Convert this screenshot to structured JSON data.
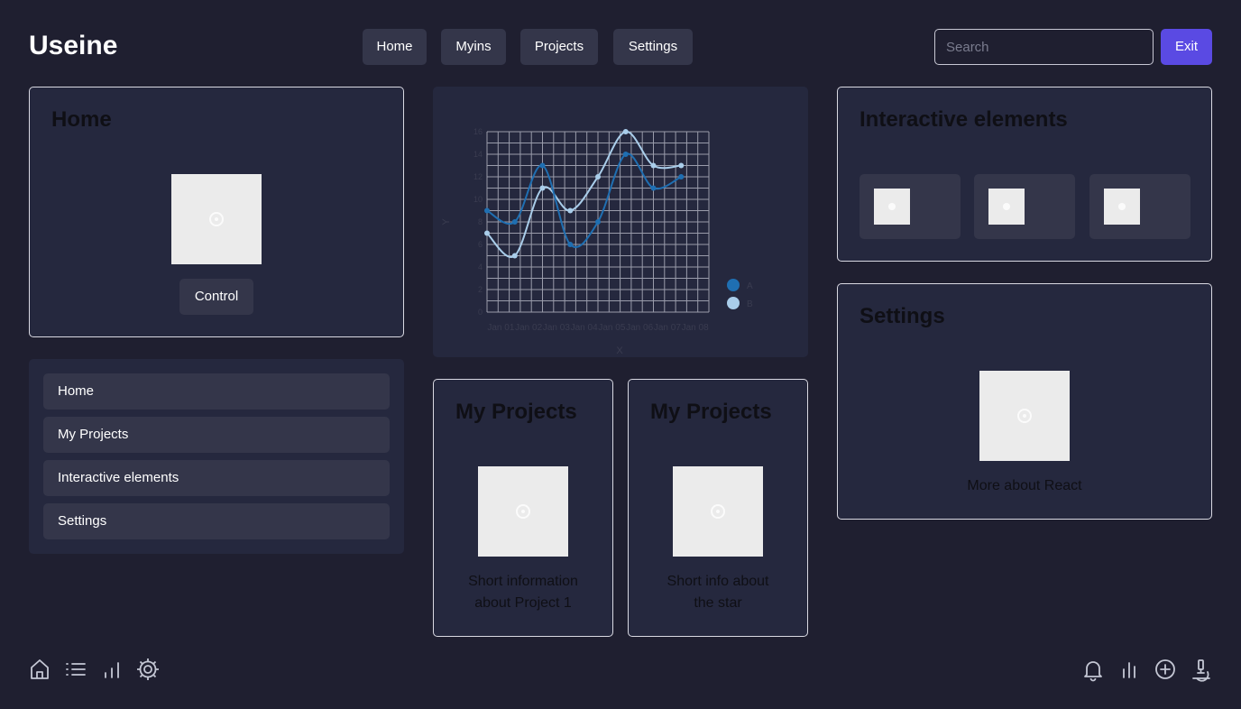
{
  "header": {
    "brand": "Useine",
    "nav": [
      {
        "label": "Home"
      },
      {
        "label": "Myins"
      },
      {
        "label": "Projects"
      },
      {
        "label": "Settings"
      }
    ],
    "search_placeholder": "Search",
    "exit_label": "Exit"
  },
  "home_card": {
    "title": "Home",
    "button_label": "Control"
  },
  "side_menu": {
    "items": [
      {
        "label": "Home"
      },
      {
        "label": "My Projects"
      },
      {
        "label": "Interactive elements"
      },
      {
        "label": "Settings"
      }
    ]
  },
  "chart_data": {
    "type": "line",
    "categories": [
      "Jan 01",
      "Jan 02",
      "Jan 03",
      "Jan 04",
      "Jan 05",
      "Jan 06",
      "Jan 07",
      "Jan 08"
    ],
    "x": [
      1,
      2,
      3,
      4,
      5,
      6,
      7,
      8,
      9
    ],
    "x_tick_labels": [
      "Jan 01",
      "Jan 02",
      "Jan 03",
      "Jan 04",
      "Jan 05",
      "Jan 06",
      "Jan 07",
      "Jan 08"
    ],
    "series": [
      {
        "name": "A",
        "color": "#1f6fb2",
        "values": [
          9,
          8,
          13,
          6,
          8,
          14,
          11,
          12
        ]
      },
      {
        "name": "B",
        "color": "#a9cdea",
        "values": [
          7,
          5,
          11,
          9,
          12,
          16,
          13,
          13
        ]
      }
    ],
    "xlabel": "X",
    "ylabel": "Y",
    "y_ticks": [
      0,
      2,
      4,
      6,
      8,
      10,
      12,
      14,
      16
    ],
    "ylim": [
      0,
      16
    ],
    "grid": true,
    "legend": "right"
  },
  "projects": [
    {
      "title": "My Projects",
      "text": "Short information about Project 1"
    },
    {
      "title": "My Projects",
      "text": "Short info about the star"
    }
  ],
  "interactive_card": {
    "title": "Interactive elements"
  },
  "settings_card": {
    "title": "Settings",
    "text": "More about React"
  },
  "footer": {
    "left_icons": [
      "home-icon",
      "list-icon",
      "bar-chart-icon",
      "gear-icon"
    ],
    "right_icons": [
      "bell-icon",
      "stats-icon",
      "add-circle-icon",
      "microscope-icon"
    ]
  },
  "colors": {
    "background": "#1f1f30",
    "card": "#25283e",
    "button": "#34364a",
    "accent": "#5a4ae3"
  }
}
